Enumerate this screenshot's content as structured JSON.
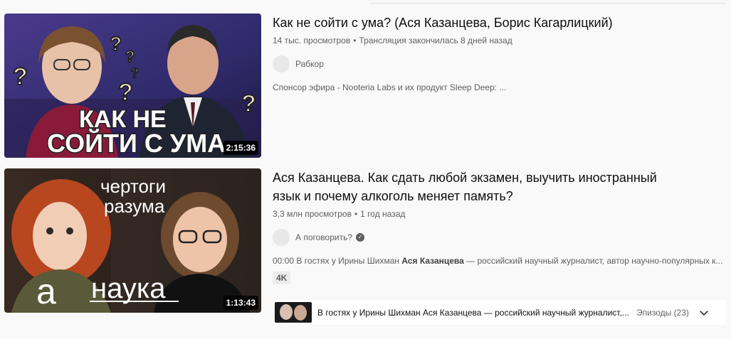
{
  "results": [
    {
      "title": "Как не сойти с ума? (Ася Казанцева, Борис Кагарлицкий)",
      "views": "14 тыс. просмотров",
      "age": "Трансляция закончилась 8 дней назад",
      "channel": "Рабкор",
      "description": "Спонсор эфира - Nooteria Labs и их продукт Sleep Deep: ...",
      "duration": "2:15:36",
      "thumb_text_line1": "КАК НЕ",
      "thumb_text_line2": "СОЙТИ С УМА"
    },
    {
      "title": "Ася Казанцева. Как сдать любой экзамен, выучить иностранный язык и почему алкоголь меняет память?",
      "views": "3,3 млн просмотров",
      "age": "1 год назад",
      "channel": "А поговорить?",
      "description_prefix": "00:00 В гостях у Ирины Шихман ",
      "description_bold": "Ася Казанцева",
      "description_rest": " — российский научный журналист, автор научно-популярных к...",
      "badge": "4K",
      "duration": "1:13:43",
      "thumb_text_top1": "чертоги",
      "thumb_text_top2": "разума",
      "thumb_logo": "а",
      "thumb_text_bottom": "наука",
      "episodes_text": "В гостях у Ирины Шихман Ася Казанцева — российский научный журналист,...",
      "episodes_count": "Эпизоды (23)"
    }
  ],
  "meta_separator": "•",
  "icons": {
    "verified": "verified-check-icon",
    "expand": "chevron-down-icon"
  }
}
